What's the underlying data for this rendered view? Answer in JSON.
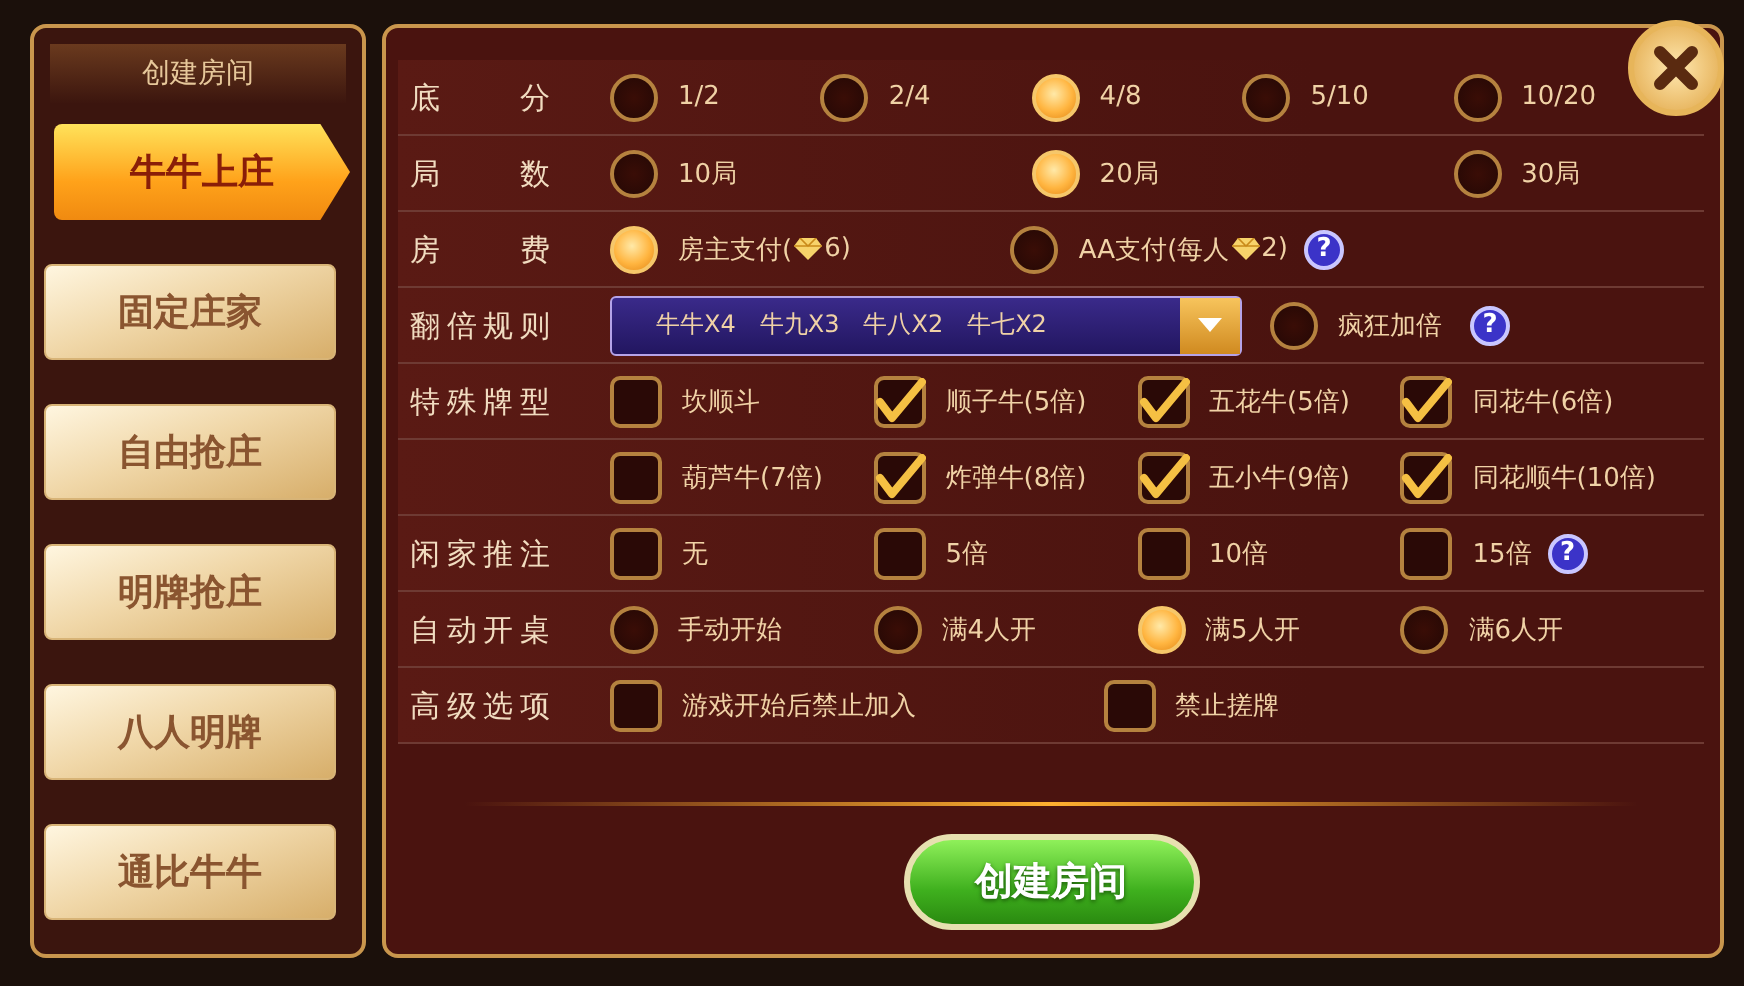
{
  "sidebar": {
    "title": "创建房间",
    "tabs": [
      {
        "label": "牛牛上庄",
        "selected": true
      },
      {
        "label": "固定庄家",
        "selected": false
      },
      {
        "label": "自由抢庄",
        "selected": false
      },
      {
        "label": "明牌抢庄",
        "selected": false
      },
      {
        "label": "八人明牌",
        "selected": false
      },
      {
        "label": "通比牛牛",
        "selected": false
      }
    ]
  },
  "rows": [
    {
      "label": "底 分",
      "kind": "radio",
      "options": [
        {
          "label": "1/2",
          "selected": false
        },
        {
          "label": "2/4",
          "selected": false
        },
        {
          "label": "4/8",
          "selected": true
        },
        {
          "label": "5/10",
          "selected": false
        },
        {
          "label": "10/20",
          "selected": false
        }
      ]
    },
    {
      "label": "局 数",
      "kind": "radio",
      "options": [
        {
          "label": "10局",
          "selected": false
        },
        {
          "label": "20局",
          "selected": true
        },
        {
          "label": "30局",
          "selected": false
        }
      ]
    },
    {
      "label": "房 费",
      "kind": "radio",
      "help": "?",
      "options": [
        {
          "label": "房主支付(",
          "gem": true,
          "label_after": "6)",
          "selected": true
        },
        {
          "label": "AA支付(每人",
          "gem": true,
          "label_after": "2)",
          "selected": false
        }
      ]
    },
    {
      "label": "翻倍规则",
      "kind": "dropdown",
      "values": [
        "牛牛X4",
        "牛九X3",
        "牛八X2",
        "牛七X2"
      ],
      "help": "?",
      "options": [
        {
          "label": "疯狂加倍",
          "selected": false
        }
      ]
    },
    {
      "label": "特殊牌型",
      "kind": "checkbox",
      "options": [
        {
          "label": "坎顺斗",
          "checked": false
        },
        {
          "label": "顺子牛(5倍)",
          "checked": true
        },
        {
          "label": "五花牛(5倍)",
          "checked": true
        },
        {
          "label": "同花牛(6倍)",
          "checked": true
        }
      ]
    },
    {
      "kind": "checkbox",
      "options": [
        {
          "label": "葫芦牛(7倍)",
          "checked": false
        },
        {
          "label": "炸弹牛(8倍)",
          "checked": true
        },
        {
          "label": "五小牛(9倍)",
          "checked": true
        },
        {
          "label": "同花顺牛(10倍)",
          "checked": true
        }
      ]
    },
    {
      "label": "闲家推注",
      "kind": "checkbox",
      "help": "?",
      "options": [
        {
          "label": "无",
          "checked": false
        },
        {
          "label": "5倍",
          "checked": false
        },
        {
          "label": "10倍",
          "checked": false
        },
        {
          "label": "15倍",
          "checked": false
        }
      ]
    },
    {
      "label": "自动开桌",
      "kind": "radio",
      "options": [
        {
          "label": "手动开始",
          "selected": false
        },
        {
          "label": "满4人开",
          "selected": false
        },
        {
          "label": "满5人开",
          "selected": true
        },
        {
          "label": "满6人开",
          "selected": false
        }
      ]
    },
    {
      "label": "高级选项",
      "kind": "checkbox",
      "options": [
        {
          "label": "游戏开始后禁止加入",
          "checked": false
        },
        {
          "label": "禁止搓牌",
          "checked": false
        }
      ]
    }
  ],
  "create_button": "创建房间"
}
